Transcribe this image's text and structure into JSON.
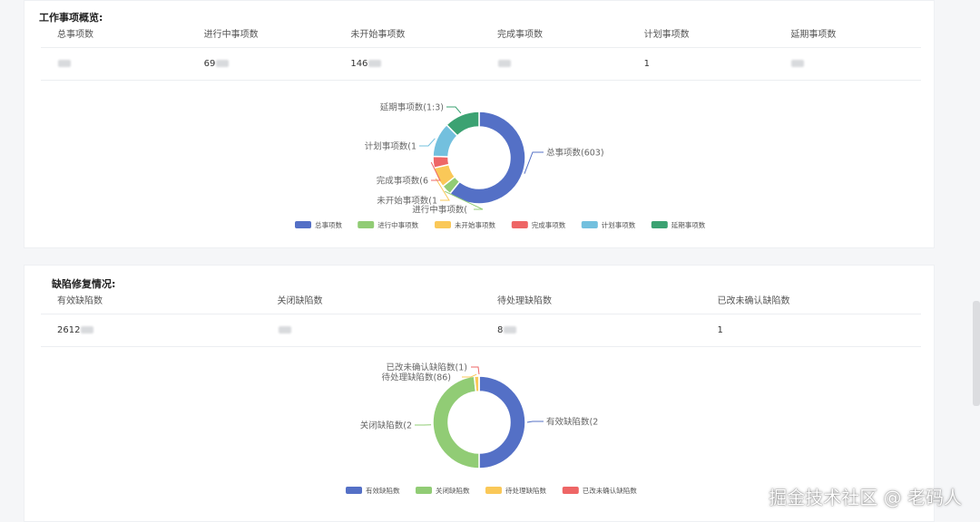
{
  "work_overview": {
    "title": "工作事项概览:",
    "columns": [
      "总事项数",
      "进行中事项数",
      "未开始事项数",
      "完成事项数",
      "计划事项数",
      "延期事项数"
    ],
    "values": [
      "",
      "69",
      "146",
      "",
      "1",
      ""
    ],
    "chart_data": {
      "type": "pie",
      "donut": true,
      "categories": [
        "总事项数",
        "进行中事项数",
        "未开始事项数",
        "完成事项数",
        "计划事项数",
        "延期事项数"
      ],
      "slice_labels": [
        "总事项数(603)",
        "进行中事项数(",
        "未开始事项数(1",
        "完成事项数(6",
        "计划事项数(1",
        "延期事项数(1:3)"
      ],
      "values": [
        603,
        35,
        70,
        40,
        120,
        123
      ],
      "colors": [
        "#5470c6",
        "#91cc75",
        "#fac858",
        "#ee6666",
        "#73c0de",
        "#3ba272"
      ],
      "legend": [
        "总事项数",
        "进行中事项数",
        "未开始事项数",
        "完成事项数",
        "计划事项数",
        "延期事项数"
      ],
      "legend_position": "bottom"
    }
  },
  "defect_repair": {
    "title": "缺陷修复情况:",
    "columns": [
      "有效缺陷数",
      "关闭缺陷数",
      "待处理缺陷数",
      "已改未确认缺陷数"
    ],
    "values": [
      "2612",
      "",
      "8",
      "1"
    ],
    "chart_data": {
      "type": "pie",
      "donut": true,
      "categories": [
        "有效缺陷数",
        "关闭缺陷数",
        "待处理缺陷数",
        "已改未确认缺陷数"
      ],
      "slice_labels": [
        "有效缺陷数(2",
        "关闭缺陷数(2",
        "待处理缺陷数(86)",
        "已改未确认缺陷数(1)"
      ],
      "values": [
        2612,
        2524,
        86,
        1
      ],
      "colors": [
        "#5470c6",
        "#91cc75",
        "#fac858",
        "#ee6666"
      ],
      "legend": [
        "有效缺陷数",
        "关闭缺陷数",
        "待处理缺陷数",
        "已改未确认缺陷数"
      ],
      "legend_position": "bottom"
    }
  },
  "watermark": "掘金技术社区 @ 老码人"
}
